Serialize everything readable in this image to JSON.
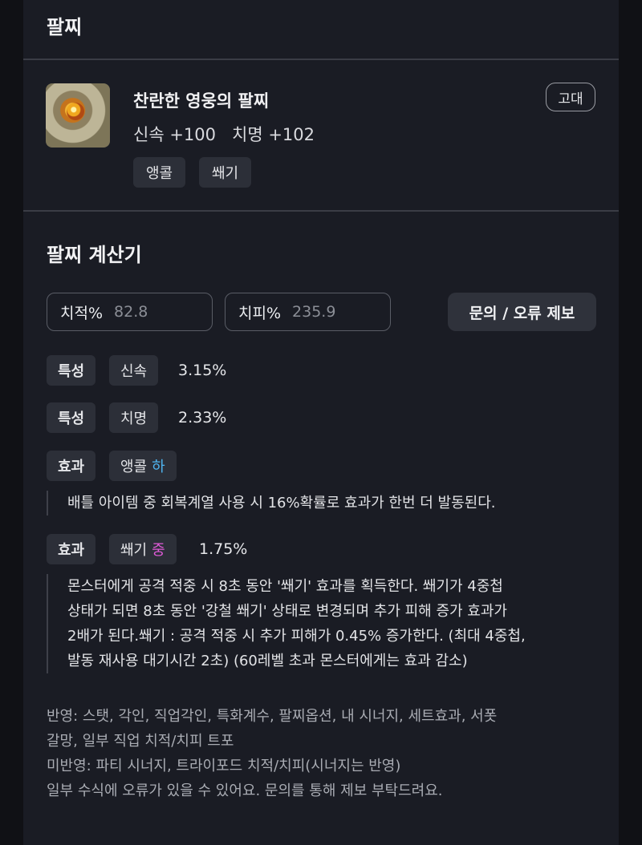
{
  "bracelet_section": {
    "title": "팔찌",
    "item": {
      "name": "찬란한 영웅의 팔찌",
      "stats": "신속 +100   치명 +102",
      "grade": "고대",
      "effect_tags": [
        "앵콜",
        "쐐기"
      ]
    }
  },
  "calculator": {
    "title": "팔찌 계산기",
    "crit_rate": {
      "label": "치적%",
      "value": "82.8"
    },
    "crit_damage": {
      "label": "치피%",
      "value": "235.9"
    },
    "report_button": "문의 / 오류 제보",
    "rows": [
      {
        "type": "특성",
        "name": "신속",
        "value": "3.15%"
      },
      {
        "type": "특성",
        "name": "치명",
        "value": "2.33%"
      }
    ],
    "effects": [
      {
        "type": "효과",
        "name": "앵콜",
        "grade": "하",
        "grade_color": "#4fb5f0",
        "value": "",
        "description": [
          "배틀 아이템 중 회복계열 사용 시 16%확률로 효과가 한번 더 발동된다."
        ]
      },
      {
        "type": "효과",
        "name": "쐐기",
        "grade": "중",
        "grade_color": "#e05bd8",
        "value": "1.75%",
        "description": [
          "몬스터에게 공격 적중 시 8초 동안 '쐐기' 효과를 획득한다. 쐐기가 4중첩",
          "상태가 되면 8초 동안 '강철 쐐기' 상태로 변경되며 추가 피해 증가 효과가",
          "2배가 된다.쐐기 : 공격 적중 시 추가 피해가 0.45% 증가한다. (최대 4중첩,",
          "발동 재사용 대기시간 2초) (60레벨 초과 몬스터에게는 효과 감소)"
        ]
      }
    ],
    "notes": [
      "반영: 스탯, 각인, 직업각인, 특화계수, 팔찌옵션, 내 시너지, 세트효과, 서폿",
      "갈망, 일부 직업 치적/치피 트포",
      "미반영: 파티 시너지, 트라이포드 치적/치피(시너지는 반영)",
      "일부 수식에 오류가 있을 수 있어요. 문의를 통해 제보 부탁드려요."
    ]
  }
}
